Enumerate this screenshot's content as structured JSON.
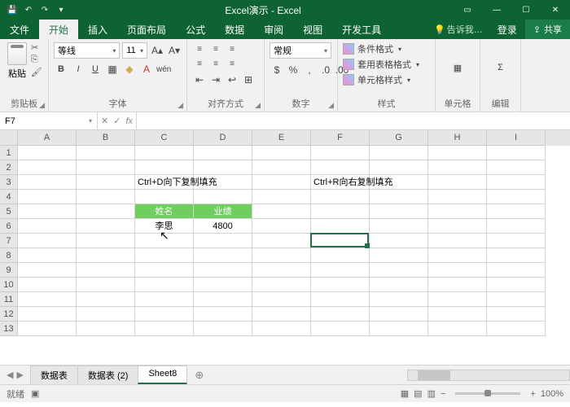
{
  "titlebar": {
    "title": "Excel演示 - Excel"
  },
  "tabs": {
    "items": [
      "文件",
      "开始",
      "插入",
      "页面布局",
      "公式",
      "数据",
      "审阅",
      "视图",
      "开发工具"
    ],
    "active": 1,
    "tell": "告诉我…",
    "signin": "登录",
    "share": "共享"
  },
  "ribbon": {
    "clipboard": {
      "label": "剪贴板",
      "paste": "粘贴"
    },
    "font": {
      "label": "字体",
      "name": "等线",
      "size": "11"
    },
    "align": {
      "label": "对齐方式"
    },
    "number": {
      "label": "数字",
      "format": "常规"
    },
    "styles": {
      "label": "样式",
      "cond": "条件格式",
      "table": "套用表格格式",
      "cell": "单元格样式"
    },
    "cells": {
      "label": "单元格"
    },
    "editing": {
      "label": "编辑"
    }
  },
  "formulabar": {
    "name": "F7",
    "fx": "fx",
    "value": ""
  },
  "grid": {
    "cols": [
      "A",
      "B",
      "C",
      "D",
      "E",
      "F",
      "G",
      "H",
      "I"
    ],
    "rows": [
      "1",
      "2",
      "3",
      "4",
      "5",
      "6",
      "7",
      "8",
      "9",
      "10",
      "11",
      "12",
      "13"
    ],
    "content": {
      "C3": "Ctrl+D向下复制填充",
      "F3": "Ctrl+R向右复制填充",
      "C5": "姓名",
      "D5": "业绩",
      "C6": "李思",
      "D6": "4800"
    },
    "headers": [
      "C5",
      "D5"
    ],
    "active": "F7"
  },
  "sheets": {
    "items": [
      "数据表",
      "数据表 (2)",
      "Sheet8"
    ],
    "active": 2
  },
  "statusbar": {
    "ready": "就绪",
    "zoom": "100%"
  },
  "chart_data": null
}
